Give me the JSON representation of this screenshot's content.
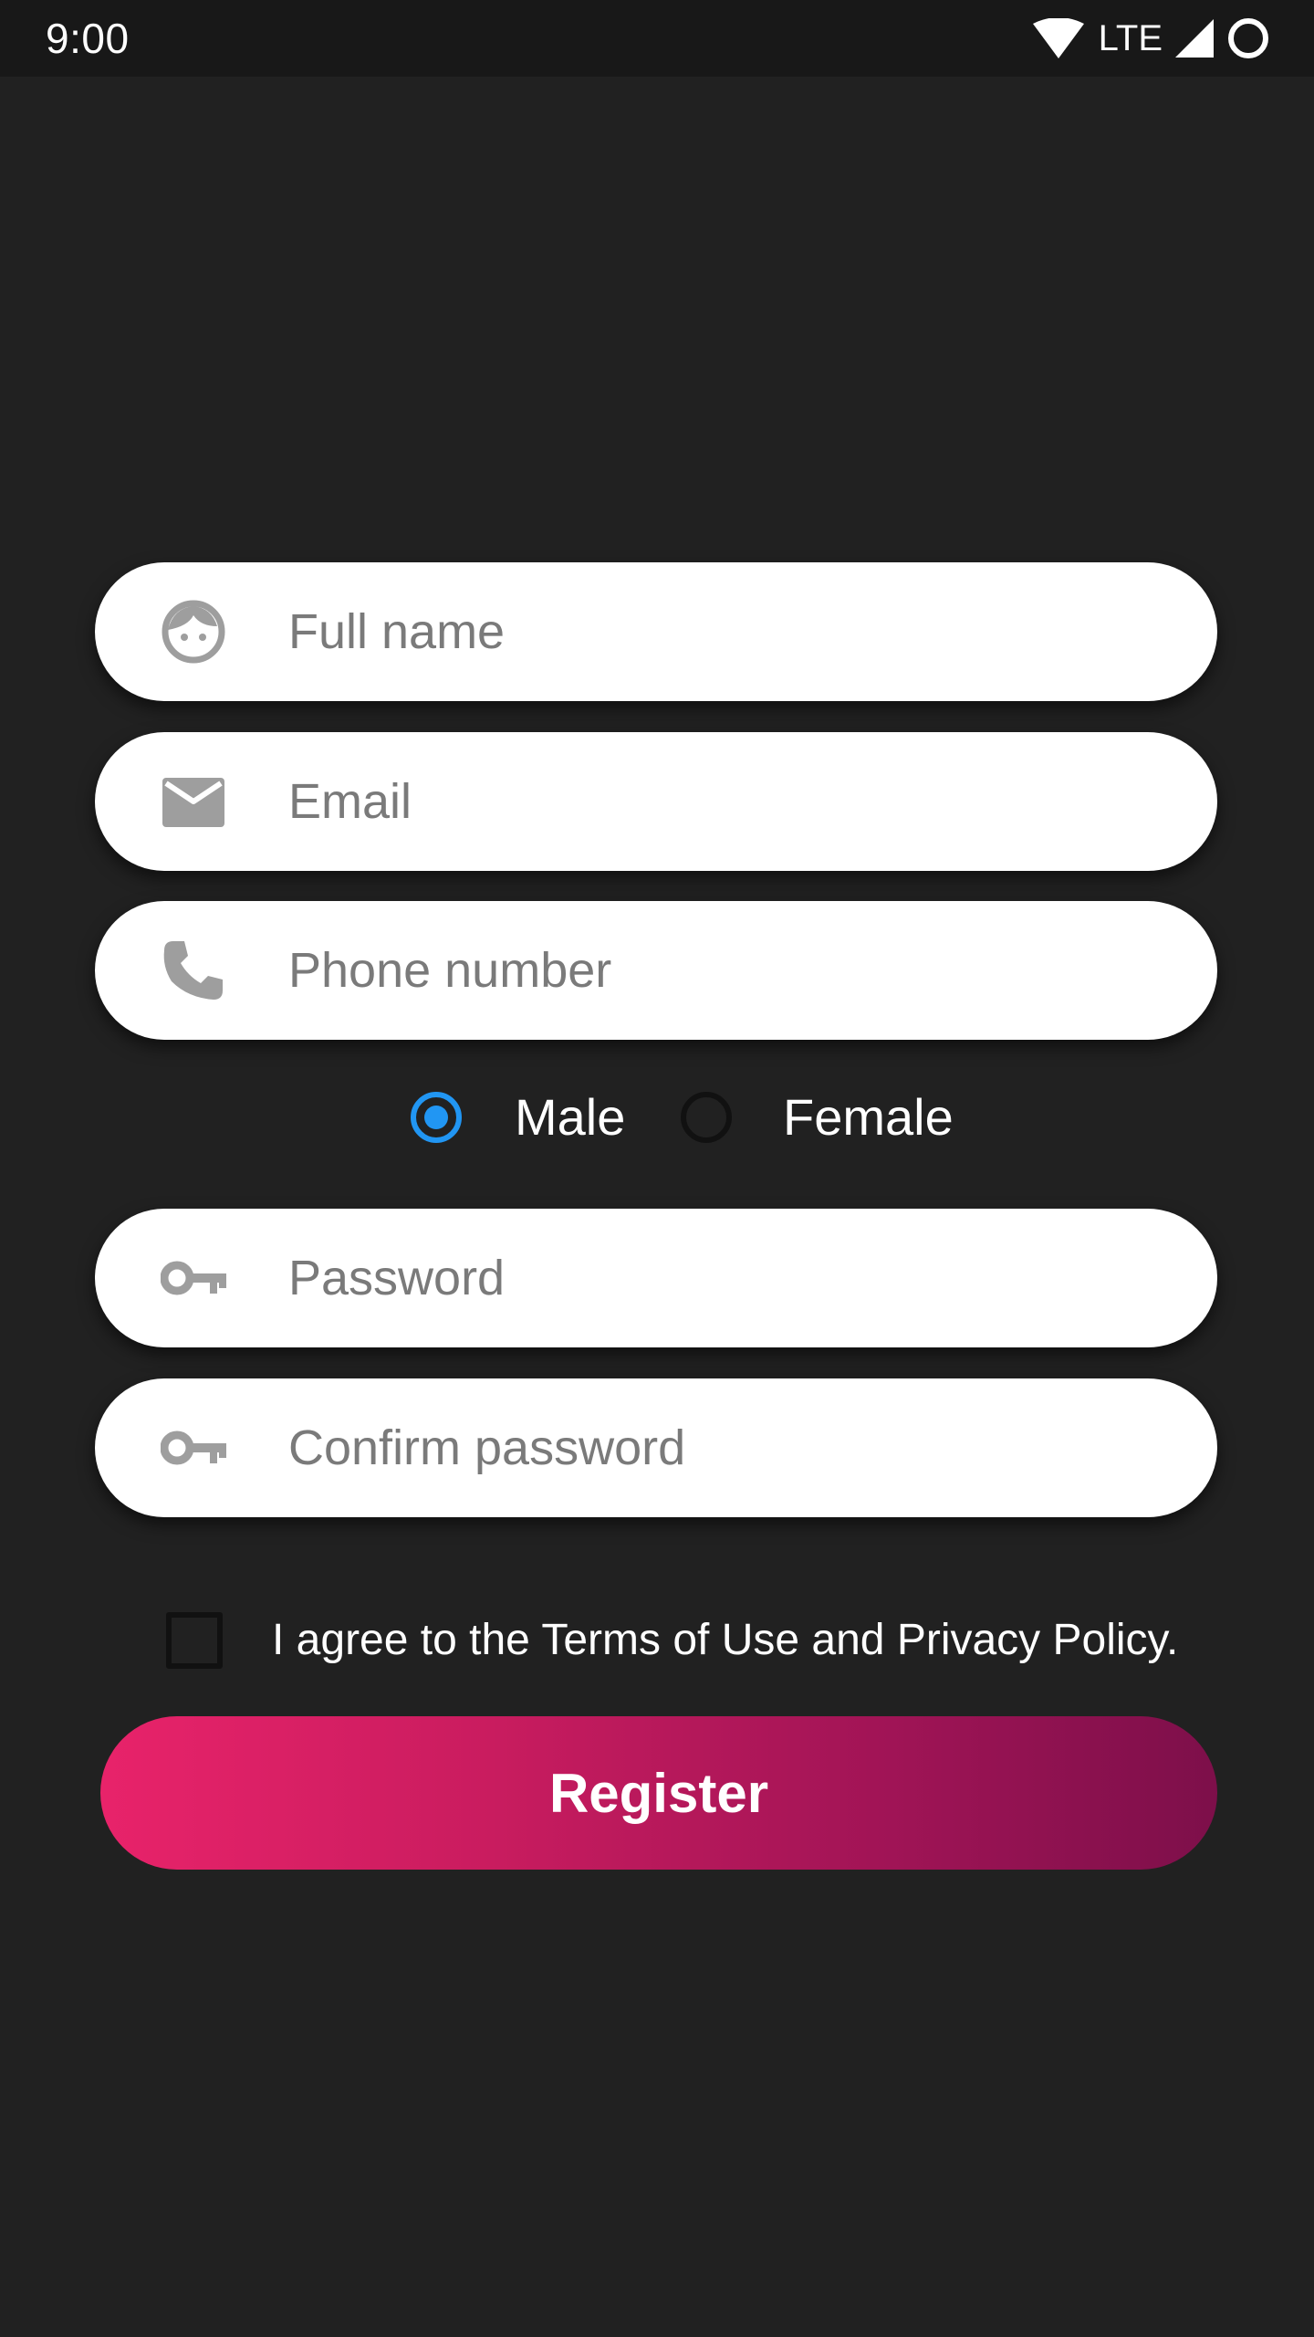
{
  "status_bar": {
    "time": "9:00",
    "network": "LTE"
  },
  "form": {
    "full_name": {
      "placeholder": "Full name",
      "icon": "face-icon"
    },
    "email": {
      "placeholder": "Email",
      "icon": "mail-icon"
    },
    "phone": {
      "placeholder": "Phone number",
      "icon": "phone-icon"
    },
    "gender": {
      "options": [
        "Male",
        "Female"
      ],
      "selected": "Male"
    },
    "password": {
      "placeholder": "Password",
      "icon": "key-icon"
    },
    "confirm_password": {
      "placeholder": "Confirm password",
      "icon": "key-icon"
    },
    "terms": {
      "label": "I agree to the Terms of Use and Privacy Policy.",
      "checked": false
    },
    "register_label": "Register"
  },
  "colors": {
    "background": "#212121",
    "status_bar": "#181818",
    "radio_selected": "#2196f3",
    "button_gradient_start": "#e8236a",
    "button_gradient_end": "#7d0f4a",
    "placeholder": "#7a7a7a",
    "icon": "#9e9e9e"
  }
}
